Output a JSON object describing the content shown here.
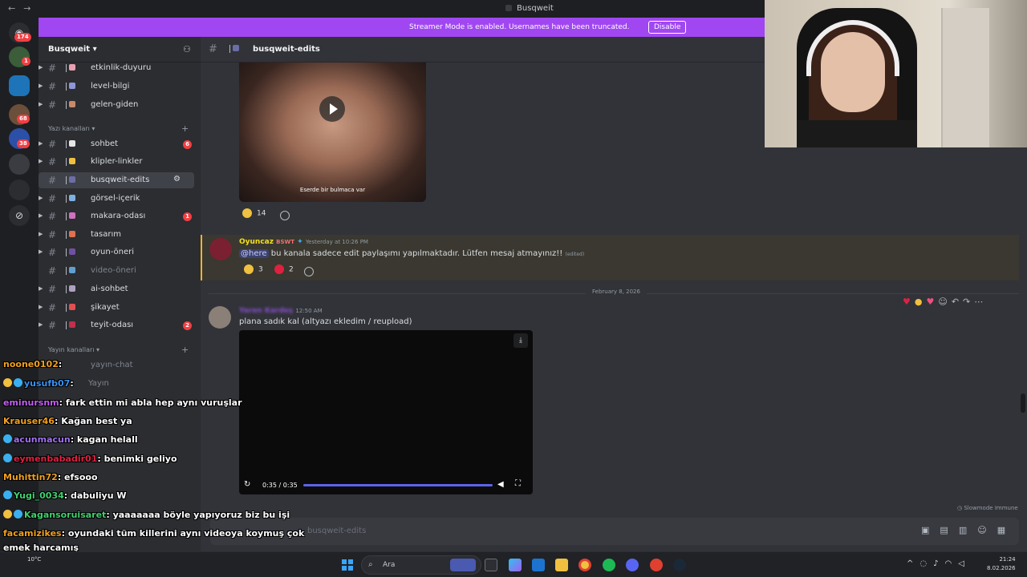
{
  "window": {
    "title": "Busqweit"
  },
  "banner": {
    "text": "Streamer Mode is enabled. Usernames have been truncated.",
    "button": "Disable"
  },
  "rail": {
    "badges": [
      "174",
      "1",
      "68",
      "38"
    ]
  },
  "server": {
    "name": "Busqweit"
  },
  "channels": [
    {
      "name": "etkinlik-duyuru"
    },
    {
      "name": "level-bilgi"
    },
    {
      "name": "gelen-giden"
    },
    {
      "name": "sohbet",
      "badge": "6"
    },
    {
      "name": "klipler-linkler"
    },
    {
      "name": "busqweit-edits"
    },
    {
      "name": "görsel-içerik"
    },
    {
      "name": "makara-odası",
      "badge": "1"
    },
    {
      "name": "tasarım"
    },
    {
      "name": "oyun-öneri"
    },
    {
      "name": "video-öneri"
    },
    {
      "name": "ai-sohbet"
    },
    {
      "name": "şikayet"
    },
    {
      "name": "teyit-odası",
      "badge": "2"
    }
  ],
  "categories": {
    "text": "Yazı kanalları",
    "voice": "Yayın kanalları"
  },
  "voice_channels": [
    "yayın-chat",
    "Yayın"
  ],
  "main": {
    "channel": "busqweit-edits",
    "video1": {
      "caption": "Eserde bir bulmaca var",
      "reaction_count": "14"
    },
    "pinned": {
      "user": "Oyuncaz",
      "tag": "BSWT",
      "time": "Yesterday at 10:26 PM",
      "mention": "@here",
      "text": "bu kanala sadece edit paylaşımı yapılmaktadır. Lütfen mesaj atmayınız!!",
      "edited": "(edited)",
      "reactions": [
        "3",
        "2"
      ]
    },
    "date_separator": "February 8, 2026",
    "message": {
      "user": "Yaren Kardeş",
      "time": "12:50 AM",
      "text": "plana sadık kal (altyazı ekledim / reupload)",
      "video_time": "0:35 / 0:35"
    },
    "slowmode": "Slowmode Immune",
    "composer_placeholder": "busqweit-edits"
  },
  "chat": [
    {
      "user": "noone0102",
      "text": ""
    },
    {
      "user": "yusufb07",
      "text": ""
    },
    {
      "user": "eminursnm",
      "text": "fark ettin mi abla hep aynı vuruşlar"
    },
    {
      "user": "Krauser46",
      "text": "Kağan best ya"
    },
    {
      "user": "acunmacun",
      "text": "kagan helall"
    },
    {
      "user": "eymenbabadir01",
      "text": "benimki geliyo"
    },
    {
      "user": "Muhittin72",
      "text": "efsooo"
    },
    {
      "user": "Yugi_0034",
      "text": "dabuliyu W"
    },
    {
      "user": "Kagansoruisaret",
      "text": "yaaaaaaa böyle yapıyoruz biz bu işi"
    },
    {
      "user": "facamizikes",
      "text": "oyundaki tüm killerini aynı videoya koymuş çok"
    },
    {
      "user": "",
      "text": "emek harcamış"
    },
    {
      "user": "yusufb07",
      "text": ""
    }
  ],
  "taskbar": {
    "weather": "10°C",
    "search": "Ara",
    "time": "21:24",
    "date": "8.02.2026"
  },
  "colors": {
    "banner": "#a047f1",
    "bg": "#313338",
    "sidebar": "#2b2d31",
    "rail": "#1e1f22"
  }
}
